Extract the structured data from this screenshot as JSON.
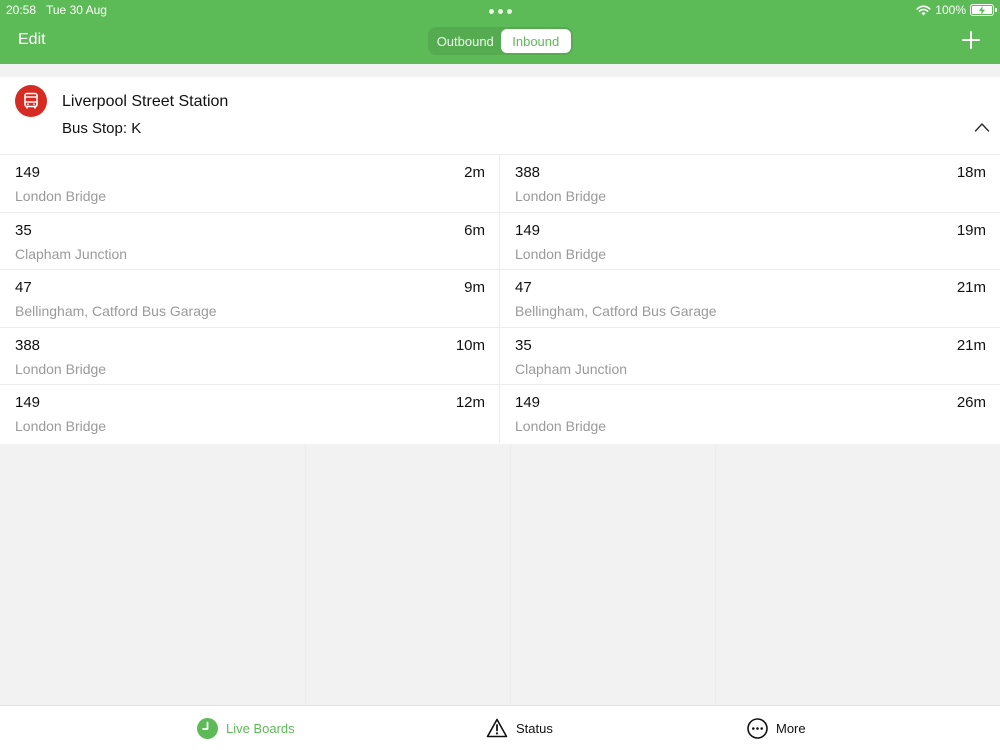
{
  "status_bar": {
    "time": "20:58",
    "date": "Tue 30 Aug",
    "battery": "100%"
  },
  "nav": {
    "edit_label": "Edit",
    "segments": [
      {
        "label": "Outbound",
        "active": false
      },
      {
        "label": "Inbound",
        "active": true
      }
    ]
  },
  "stop": {
    "name": "Liverpool Street Station",
    "code": "Bus Stop: K",
    "icon": "bus-icon"
  },
  "arrivals": {
    "left": [
      {
        "route": "149",
        "destination": "London Bridge",
        "eta": "2m"
      },
      {
        "route": "35",
        "destination": "Clapham Junction",
        "eta": "6m"
      },
      {
        "route": "47",
        "destination": "Bellingham, Catford Bus Garage",
        "eta": "9m"
      },
      {
        "route": "388",
        "destination": "London Bridge",
        "eta": "10m"
      },
      {
        "route": "149",
        "destination": "London Bridge",
        "eta": "12m"
      }
    ],
    "right": [
      {
        "route": "388",
        "destination": "London Bridge",
        "eta": "18m"
      },
      {
        "route": "149",
        "destination": "London Bridge",
        "eta": "19m"
      },
      {
        "route": "47",
        "destination": "Bellingham, Catford Bus Garage",
        "eta": "21m"
      },
      {
        "route": "35",
        "destination": "Clapham Junction",
        "eta": "21m"
      },
      {
        "route": "149",
        "destination": "London Bridge",
        "eta": "26m"
      }
    ]
  },
  "tabbar": {
    "items": [
      {
        "label": "Live Boards",
        "icon": "clock-icon",
        "active": true
      },
      {
        "label": "Status",
        "icon": "warning-icon",
        "active": false
      },
      {
        "label": "More",
        "icon": "more-icon",
        "active": false
      }
    ]
  },
  "colors": {
    "brand_green": "#5dbb57",
    "bus_red": "#d52b22",
    "secondary_text": "#9a9a9a"
  }
}
